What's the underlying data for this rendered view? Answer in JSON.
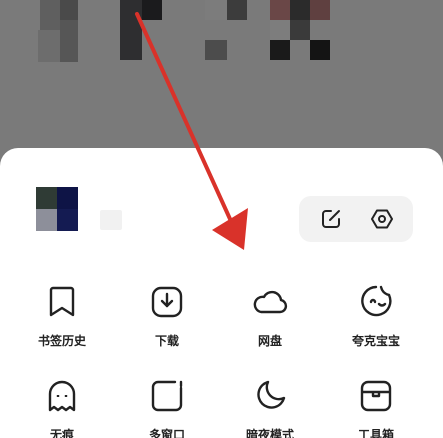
{
  "colors": {
    "backdrop": "#7a7a7a",
    "sheet": "#ffffff",
    "arrow": "#d9322a",
    "icon_stroke": "#222222"
  },
  "header": {
    "edit_icon": "edit-icon",
    "settings_icon": "settings-icon"
  },
  "menu": {
    "bookmarks_history": "书签历史",
    "downloads": "下载",
    "cloud_drive": "网盘",
    "kuake_baby": "夸克宝宝",
    "incognito": "无痕",
    "multi_window": "多窗口",
    "dark_mode": "暗夜模式",
    "toolbox": "工具箱"
  }
}
